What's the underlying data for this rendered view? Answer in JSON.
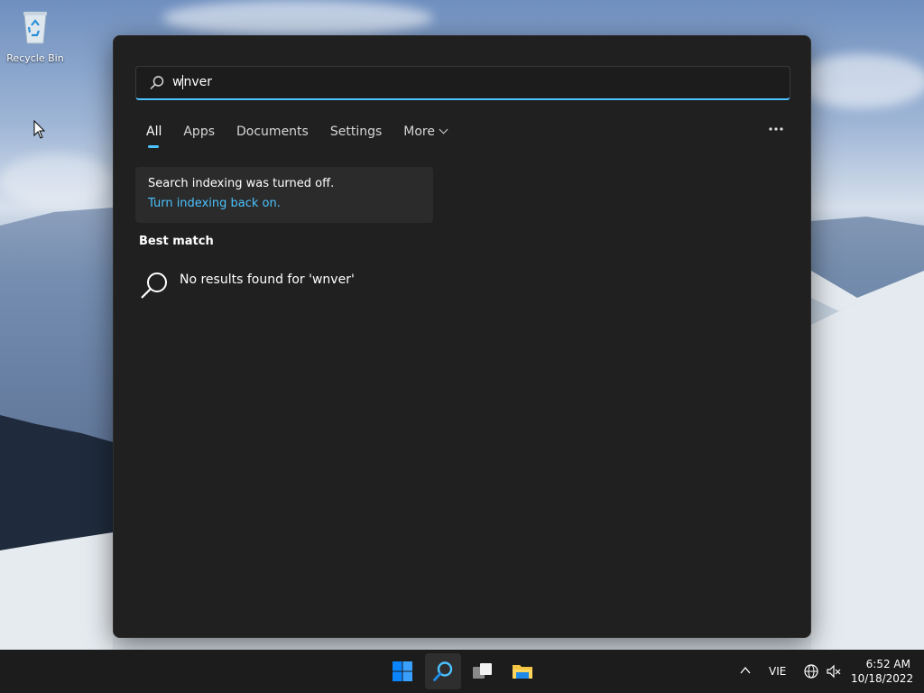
{
  "desktop": {
    "icons": [
      {
        "label": "Recycle Bin",
        "icon": "recycle-bin-icon"
      }
    ]
  },
  "search": {
    "query": "wnver",
    "query_before_caret": "w",
    "query_after_caret": "nver",
    "accent_color": "#4cc2ff",
    "tabs": [
      {
        "label": "All",
        "active": true
      },
      {
        "label": "Apps",
        "active": false
      },
      {
        "label": "Documents",
        "active": false
      },
      {
        "label": "Settings",
        "active": false
      },
      {
        "label": "More",
        "active": false
      }
    ],
    "options_icon": "more-options-icon",
    "notice": {
      "message": "Search indexing was turned off.",
      "link": "Turn indexing back on."
    },
    "best_match_heading": "Best match",
    "no_results_text": "No results found for 'wnver'"
  },
  "taskbar": {
    "apps": [
      {
        "name": "start",
        "icon": "windows-logo-icon"
      },
      {
        "name": "search",
        "icon": "search-icon",
        "active": true
      },
      {
        "name": "task-view",
        "icon": "task-view-icon"
      },
      {
        "name": "file-explorer",
        "icon": "folder-icon"
      }
    ],
    "tray": {
      "language": "VIE",
      "time": "6:52 AM",
      "date": "10/18/2022"
    }
  }
}
